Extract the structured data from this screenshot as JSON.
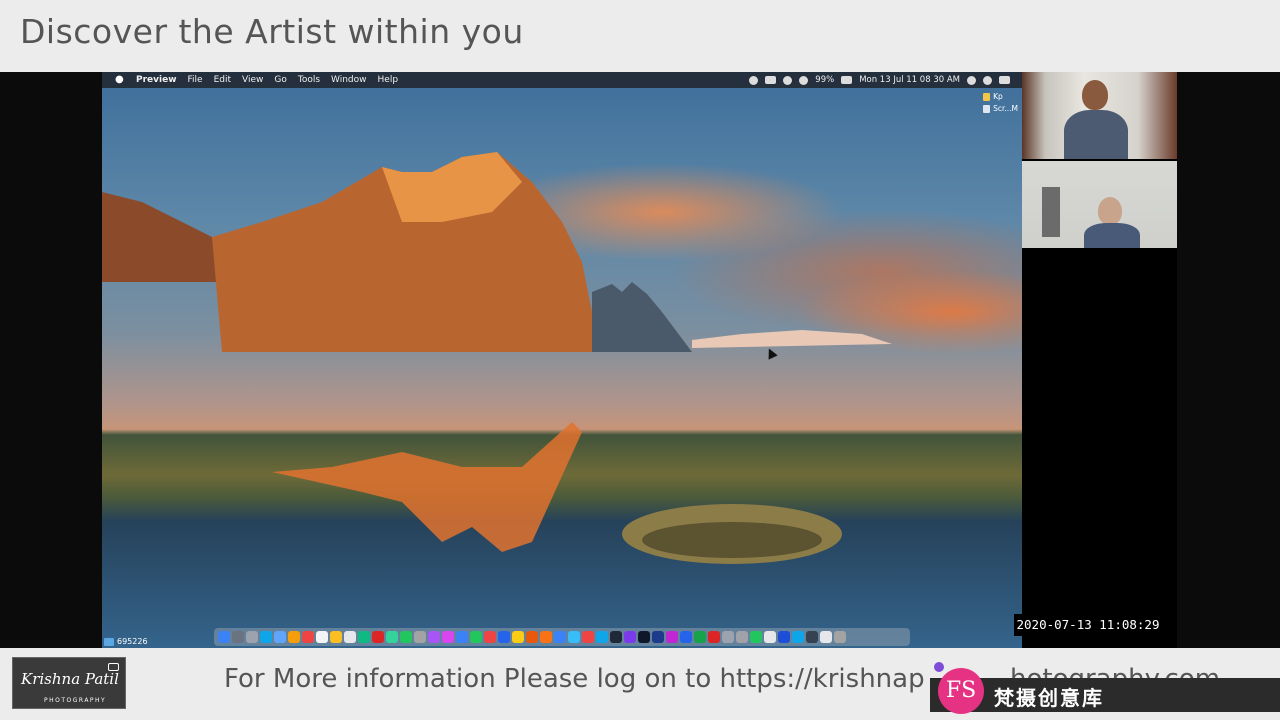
{
  "top_banner": {
    "title": "Discover the Artist within you"
  },
  "mac_screen": {
    "menubar": {
      "apple_symbol": "",
      "items": [
        "Preview",
        "File",
        "Edit",
        "View",
        "Go",
        "Tools",
        "Window",
        "Help"
      ],
      "status": {
        "battery": "99%",
        "datetime": "Mon 13 Jul  11 08 30 AM"
      }
    },
    "desktop_files": [
      "Kp",
      "Scr...M"
    ],
    "folder_badge": "695226"
  },
  "video_overlay": {
    "timestamp": "2020-07-13  11:08:29"
  },
  "bottom_banner": {
    "logo_script": "Krishna Patil",
    "logo_sub": "PHOTOGRAPHY",
    "info": "For More information Please log on to https://krishnap",
    "info_tail": "hotography.com"
  },
  "watermark": {
    "badge": "FS",
    "text": "梵摄创意库"
  },
  "colors": {
    "banner_bg": "#ececec",
    "watermark_badge": "#e63282"
  }
}
